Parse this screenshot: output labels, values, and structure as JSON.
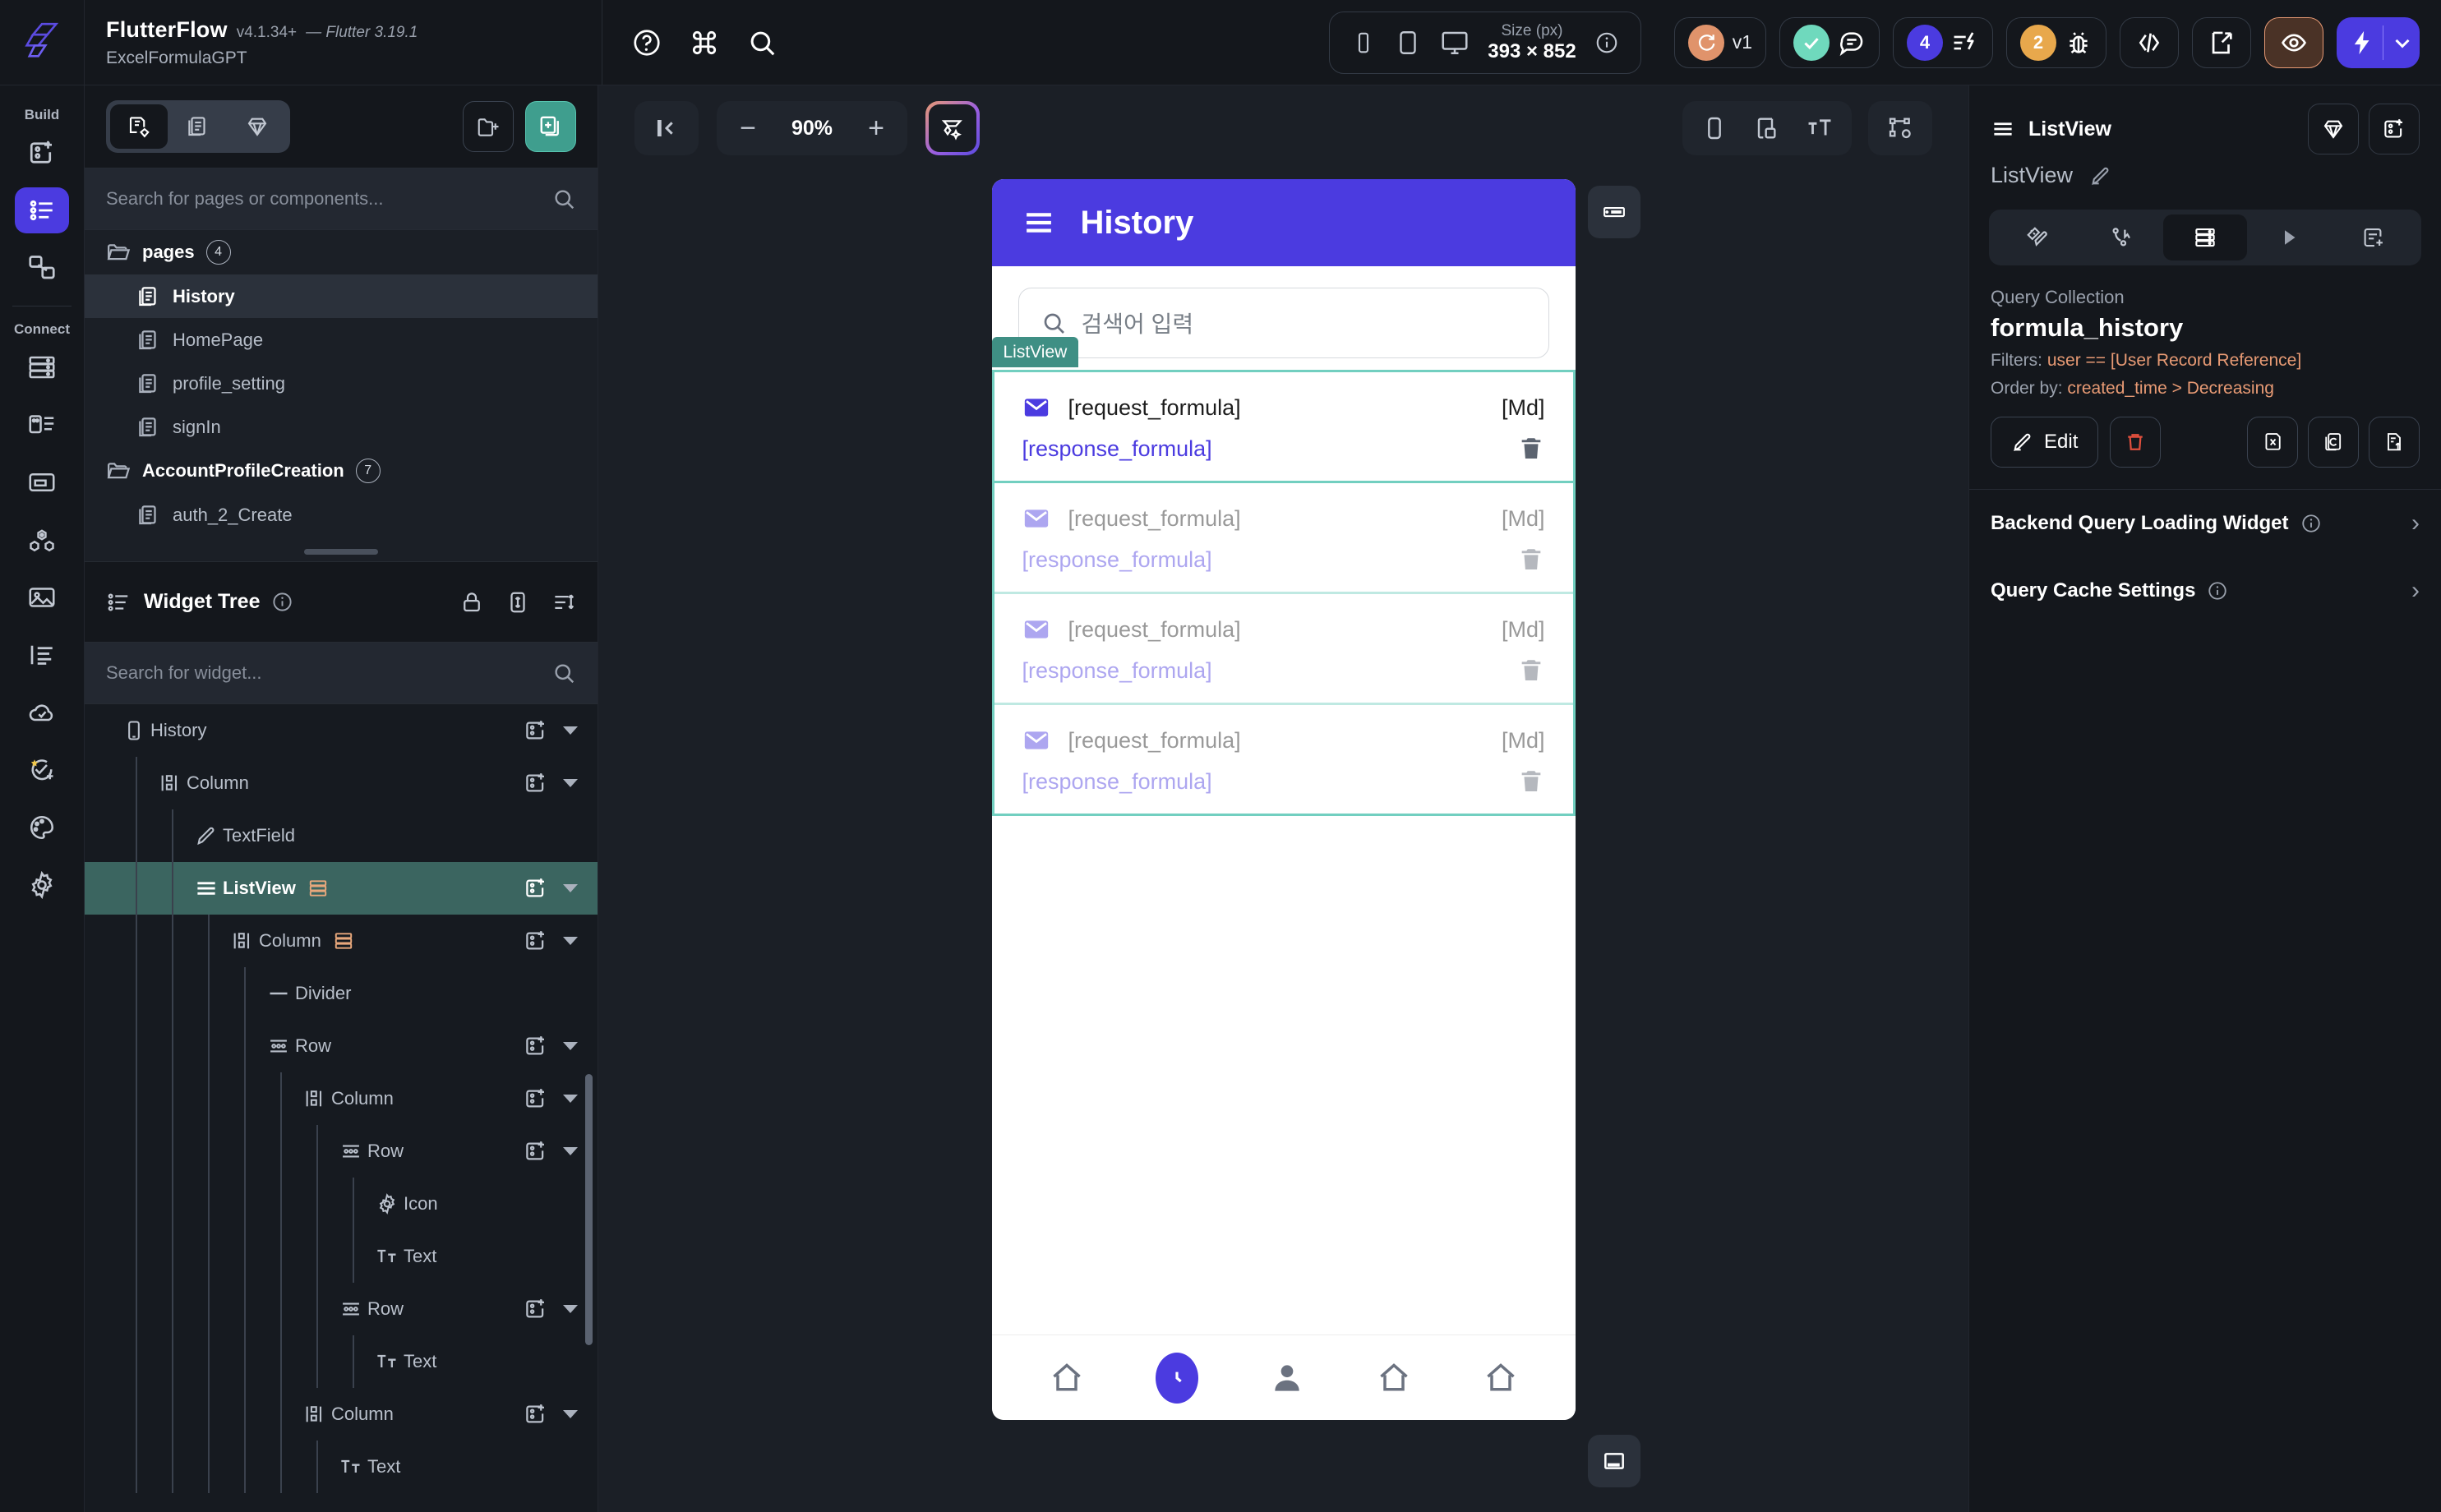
{
  "topbar": {
    "brand_name": "FlutterFlow",
    "version": "v4.1.34+",
    "flutter_version": "— Flutter 3.19.1",
    "project_name": "ExcelFormulaGPT",
    "icons": [
      "help-icon",
      "command-icon",
      "search-icon"
    ],
    "size_label": "Size (px)",
    "size_value": "393 × 852",
    "version_badge": "v1",
    "alerts_count": "4",
    "issues_count": "2"
  },
  "rail": {
    "build_label": "Build",
    "connect_label": "Connect",
    "build_items": [
      "widget-add-icon",
      "page-list-icon",
      "link-nodes-icon"
    ],
    "connect_items": [
      "database-icon",
      "app-state-icon",
      "media-folder-icon",
      "integrations-icon",
      "media-assets-icon",
      "text-styles-icon",
      "cloud-functions-icon",
      "tests-icon",
      "theme-palette-icon",
      "settings-gear-icon"
    ]
  },
  "pages_panel": {
    "search_placeholder": "Search for pages or components...",
    "folders": [
      {
        "name": "pages",
        "count": "4",
        "pages": [
          {
            "name": "History",
            "active": true
          },
          {
            "name": "HomePage",
            "active": false
          },
          {
            "name": "profile_setting",
            "active": false
          },
          {
            "name": "signIn",
            "active": false
          }
        ]
      },
      {
        "name": "AccountProfileCreation",
        "count": "7",
        "pages": [
          {
            "name": "auth_2_Create",
            "active": false
          }
        ]
      }
    ]
  },
  "widget_tree": {
    "title": "Widget Tree",
    "search_placeholder": "Search for widget...",
    "nodes": [
      {
        "label": "History",
        "icon": "phone-icon",
        "depth": 0,
        "selected": false,
        "has_add": true,
        "has_caret": true,
        "orange_badge": false
      },
      {
        "label": "Column",
        "icon": "column-icon",
        "depth": 1,
        "selected": false,
        "has_add": true,
        "has_caret": true,
        "orange_badge": false
      },
      {
        "label": "TextField",
        "icon": "textfield-icon",
        "depth": 2,
        "selected": false,
        "has_add": false,
        "has_caret": false,
        "orange_badge": false
      },
      {
        "label": "ListView",
        "icon": "listview-icon",
        "depth": 2,
        "selected": true,
        "has_add": true,
        "has_caret": true,
        "orange_badge": true
      },
      {
        "label": "Column",
        "icon": "column-icon",
        "depth": 3,
        "selected": false,
        "has_add": true,
        "has_caret": true,
        "orange_badge": true
      },
      {
        "label": "Divider",
        "icon": "divider-icon",
        "depth": 4,
        "selected": false,
        "has_add": false,
        "has_caret": false,
        "orange_badge": false
      },
      {
        "label": "Row",
        "icon": "row-icon",
        "depth": 4,
        "selected": false,
        "has_add": true,
        "has_caret": true,
        "orange_badge": false
      },
      {
        "label": "Column",
        "icon": "column-icon",
        "depth": 5,
        "selected": false,
        "has_add": true,
        "has_caret": true,
        "orange_badge": false
      },
      {
        "label": "Row",
        "icon": "row-icon",
        "depth": 6,
        "selected": false,
        "has_add": true,
        "has_caret": true,
        "orange_badge": false
      },
      {
        "label": "Icon",
        "icon": "gear-icon",
        "depth": 7,
        "selected": false,
        "has_add": false,
        "has_caret": false,
        "orange_badge": false
      },
      {
        "label": "Text",
        "icon": "text-icon",
        "depth": 7,
        "selected": false,
        "has_add": false,
        "has_caret": false,
        "orange_badge": false
      },
      {
        "label": "Row",
        "icon": "row-icon",
        "depth": 6,
        "selected": false,
        "has_add": true,
        "has_caret": true,
        "orange_badge": false
      },
      {
        "label": "Text",
        "icon": "text-icon",
        "depth": 7,
        "selected": false,
        "has_add": false,
        "has_caret": false,
        "orange_badge": false
      },
      {
        "label": "Column",
        "icon": "column-icon",
        "depth": 5,
        "selected": false,
        "has_add": true,
        "has_caret": true,
        "orange_badge": false
      },
      {
        "label": "Text",
        "icon": "text-icon",
        "depth": 6,
        "selected": false,
        "has_add": false,
        "has_caret": false,
        "orange_badge": false
      }
    ]
  },
  "canvas": {
    "zoom": "90%",
    "minus_label": "−",
    "plus_label": "+",
    "left_icons": [
      "collapse-panel-icon"
    ],
    "right_icons": [
      "device-preview-icon",
      "split-view-icon",
      "text-size-icon",
      "layout-constraints-icon"
    ]
  },
  "phone": {
    "appbar_title": "History",
    "menu_icon": "hamburger-menu-icon",
    "appbar_color": "#4B3BE0",
    "search_placeholder": "검색어 입력",
    "listview_badge": "ListView",
    "selection_color": "#72CFC0",
    "items": [
      {
        "request": "[request_formula]",
        "md": "[Md]",
        "response": "[response_formula]",
        "faded": false
      },
      {
        "request": "[request_formula]",
        "md": "[Md]",
        "response": "[response_formula]",
        "faded": true
      },
      {
        "request": "[request_formula]",
        "md": "[Md]",
        "response": "[response_formula]",
        "faded": true
      },
      {
        "request": "[request_formula]",
        "md": "[Md]",
        "response": "[response_formula]",
        "faded": true
      }
    ],
    "bottom_nav": [
      {
        "icon": "home-icon",
        "active": false
      },
      {
        "icon": "clock-icon",
        "active": true
      },
      {
        "icon": "person-icon",
        "active": false
      },
      {
        "icon": "home-icon",
        "active": false
      },
      {
        "icon": "home-icon",
        "active": false
      }
    ]
  },
  "right_panel": {
    "header_title": "ListView",
    "widget_name": "ListView",
    "tabs": [
      "design-properties-icon",
      "actions-flow-icon",
      "backend-query-icon",
      "run-preview-icon",
      "add-note-icon"
    ],
    "active_tab_index": 2,
    "query_label": "Query Collection",
    "collection_name": "formula_history",
    "filters_label": "Filters:",
    "filters_value": "user == [User Record Reference]",
    "orderby_label": "Order by:",
    "orderby_value": "created_time > Decreasing",
    "edit_label": "Edit",
    "rows": [
      {
        "label": "Backend Query Loading Widget"
      },
      {
        "label": "Query Cache Settings"
      }
    ]
  }
}
